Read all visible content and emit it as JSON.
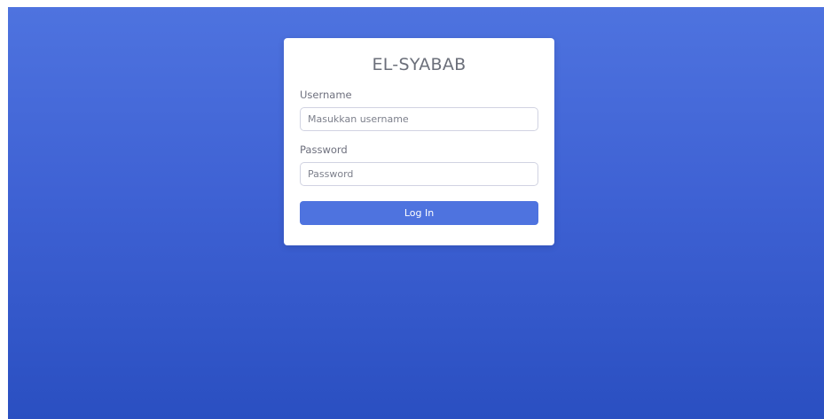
{
  "login": {
    "brand": "EL-SYABAB",
    "username_label": "Username",
    "username_placeholder": "Masukkan username",
    "username_value": "",
    "password_label": "Password",
    "password_placeholder": "Password",
    "password_value": "",
    "submit_label": "Log In"
  },
  "colors": {
    "background_top": "#4e73df",
    "background_bottom": "#2a4fc1",
    "card": "#ffffff",
    "button": "#4e73df"
  }
}
